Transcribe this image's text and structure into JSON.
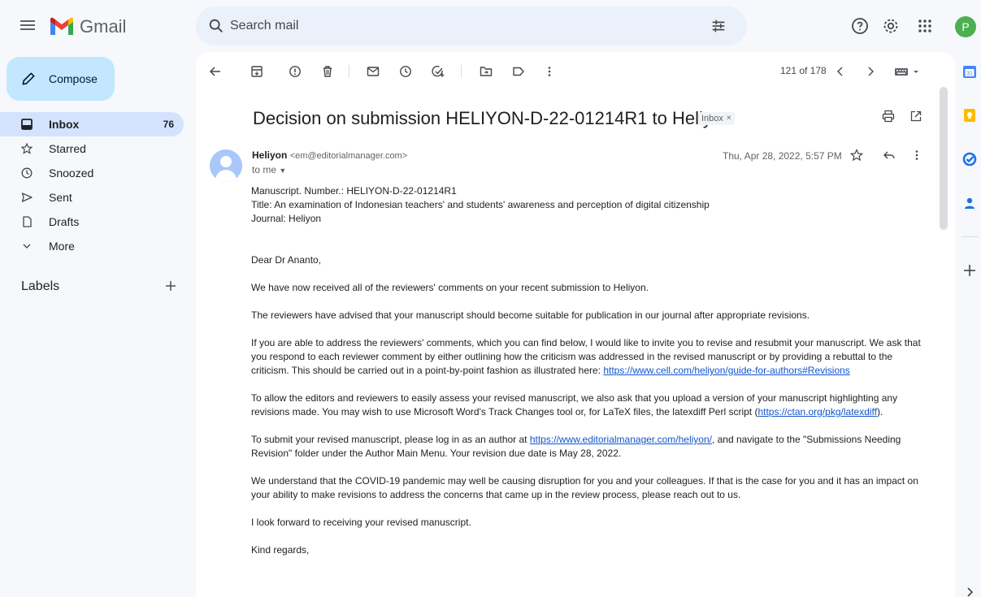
{
  "header": {
    "app_name": "Gmail",
    "search_placeholder": "Search mail",
    "avatar_initial": "P"
  },
  "sidebar": {
    "compose_label": "Compose",
    "items": [
      {
        "label": "Inbox",
        "count": "76",
        "icon": "inbox-icon",
        "active": true
      },
      {
        "label": "Starred",
        "count": "",
        "icon": "star-icon"
      },
      {
        "label": "Snoozed",
        "count": "",
        "icon": "clock-icon"
      },
      {
        "label": "Sent",
        "count": "",
        "icon": "send-icon"
      },
      {
        "label": "Drafts",
        "count": "",
        "icon": "draft-icon"
      },
      {
        "label": "More",
        "count": "",
        "icon": "chevron-down-icon"
      }
    ],
    "labels_heading": "Labels"
  },
  "toolbar": {
    "pager": "121 of 178"
  },
  "email": {
    "subject": "Decision on submission HELIYON-D-22-01214R1 to Heliyon",
    "label_chip": "Inbox",
    "sender_name": "Heliyon",
    "sender_email": "<em@editorialmanager.com>",
    "to": "to me",
    "date": "Thu, Apr 28, 2022, 5:57 PM",
    "meta_manuscript": "Manuscript. Number.: HELIYON-D-22-01214R1",
    "meta_title": "Title: An examination of Indonesian teachers' and students' awareness and perception of digital citizenship",
    "meta_journal": "Journal: Heliyon",
    "greeting": "Dear Dr Ananto,",
    "p1": "We have now received all of the reviewers' comments on your recent submission to Heliyon.",
    "p2": "The reviewers have advised that your manuscript should become suitable for publication in our journal after appropriate revisions.",
    "p3_text": "If you are able to address the reviewers' comments, which you can find below, I would like to invite you to revise and resubmit your manuscript. We ask that you respond to each reviewer comment by either outlining how the criticism was addressed in the revised manuscript or by providing a rebuttal to the criticism. This should be carried out in a point-by-point fashion as illustrated here: ",
    "p3_link": "https://www.cell.com/heliyon/guide-for-authors#Revisions",
    "p4_text": "To allow the editors and reviewers to easily assess your revised manuscript, we also ask that you upload a version of your manuscript highlighting any revisions made. You may wish to use Microsoft Word's Track Changes tool or, for LaTeX files, the latexdiff Perl script (",
    "p4_link": "https://ctan.org/pkg/latexdiff",
    "p4_end": ").",
    "p5_text": "To submit your revised manuscript, please log in as an author at ",
    "p5_link": "https://www.editorialmanager.com/heliyon/",
    "p5_end": ", and navigate to the \"Submissions Needing Revision\" folder under the Author Main Menu. Your revision due date is May 28, 2022.",
    "p6": "We understand that the COVID-19 pandemic may well be causing disruption for you and your colleagues. If that is the case for you and it has an impact on your ability to make revisions to address the concerns that came up in the review process, please reach out to us.",
    "p7": "I look forward to receiving your revised manuscript.",
    "p8": "Kind regards,"
  },
  "colors": {
    "background": "#f6f8fc",
    "compose": "#c2e7ff",
    "active_nav": "#d3e3fd",
    "search": "#eaf1fb",
    "link": "#1155cc",
    "avatar": "#4caf50"
  }
}
